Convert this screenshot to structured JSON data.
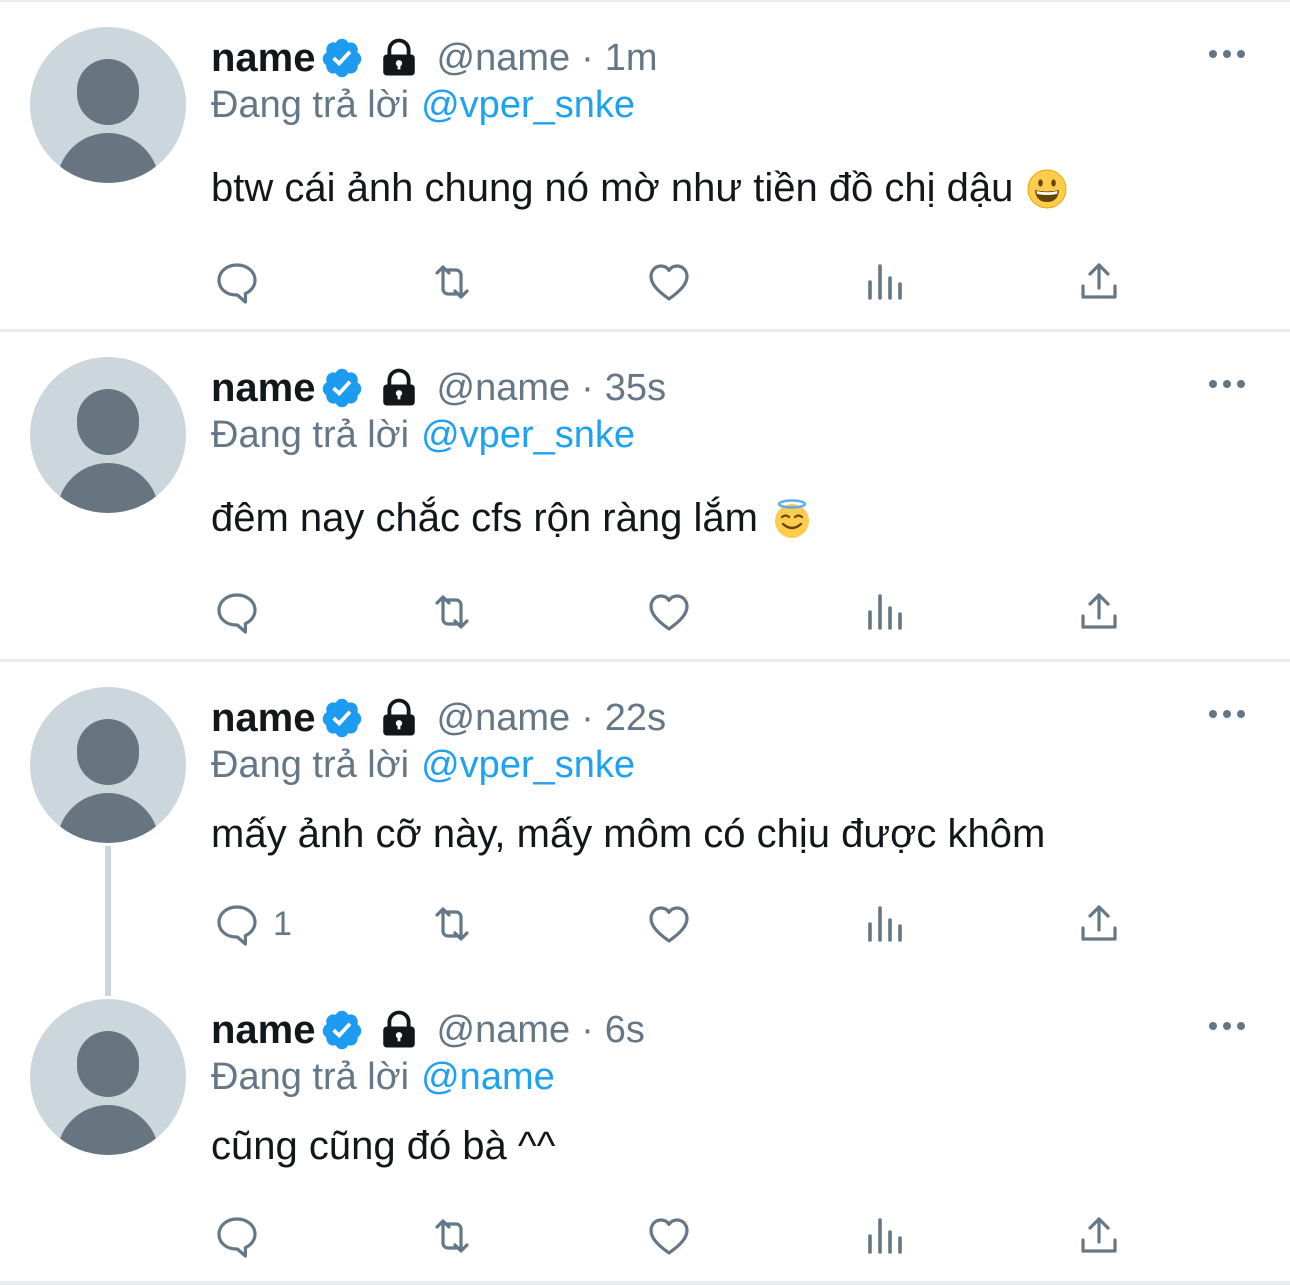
{
  "colors": {
    "divider": "#e9ecef",
    "text_primary": "#14171a",
    "text_secondary": "#657786",
    "link": "#1da1f2",
    "verified": "#1d9bf0",
    "avatar_bg": "#ccd6dd",
    "avatar_fg": "#66757f"
  },
  "icons": {
    "reply": "reply-icon",
    "retweet": "retweet-icon",
    "like": "heart-icon",
    "views": "analytics-icon",
    "share": "share-icon",
    "more": "more-icon",
    "verified": "verified-badge-icon",
    "protected": "lock-icon"
  },
  "tweets": [
    {
      "name": "name",
      "handle": "@name",
      "separator": "·",
      "time": "1m",
      "reply_prefix": "Đang trả lời",
      "reply_to": "@vper_snke",
      "text": "btw cái ảnh chung nó mờ như tiền đồ chị dậu",
      "emoji": "grinning-face",
      "reply_count": ""
    },
    {
      "name": "name",
      "handle": "@name",
      "separator": "·",
      "time": "35s",
      "reply_prefix": "Đang trả lời",
      "reply_to": "@vper_snke",
      "text": "đêm nay chắc cfs rộn ràng lắm",
      "emoji": "smiling-face-with-halo",
      "reply_count": ""
    },
    {
      "name": "name",
      "handle": "@name",
      "separator": "·",
      "time": "22s",
      "reply_prefix": "Đang trả lời",
      "reply_to": "@vper_snke",
      "text": "mấy ảnh cỡ này, mấy môm có chịu được khôm",
      "emoji": "",
      "reply_count": "1"
    },
    {
      "name": "name",
      "handle": "@name",
      "separator": "·",
      "time": "6s",
      "reply_prefix": "Đang trả lời",
      "reply_to": "@name",
      "text": "cũng cũng đó bà ^^",
      "emoji": "",
      "reply_count": ""
    }
  ]
}
